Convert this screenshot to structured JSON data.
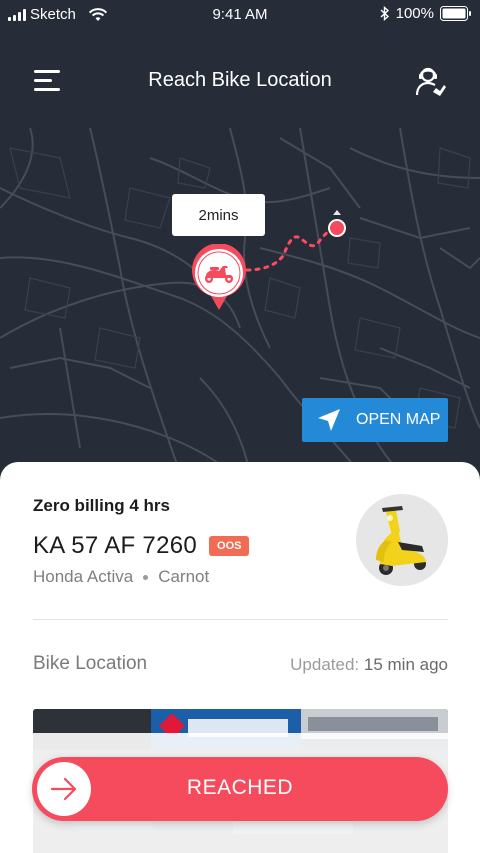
{
  "status_bar": {
    "carrier": "Sketch",
    "time": "9:41 AM",
    "battery": "100%"
  },
  "header": {
    "title": "Reach Bike Location",
    "menu_icon": "menu-icon",
    "support_icon": "support-agent-icon"
  },
  "map": {
    "eta": "2mins",
    "open_map_label": "OPEN MAP",
    "open_map_icon": "navigation-arrow-icon"
  },
  "bike": {
    "billing": "Zero billing 4 hrs",
    "plate": "KA 57 AF 7260",
    "badge": "OOS",
    "model": "Honda Activa",
    "location_name": "Carnot"
  },
  "location": {
    "label": "Bike Location",
    "updated_label": "Updated:",
    "updated_value": "15 min ago"
  },
  "action": {
    "reached_label": "REACHED",
    "arrow_icon": "arrow-right-icon"
  },
  "colors": {
    "header_bg": "#262c38",
    "accent_red": "#f54b5c",
    "map_button_blue": "#2489d6",
    "badge_orange": "#f26b53"
  }
}
